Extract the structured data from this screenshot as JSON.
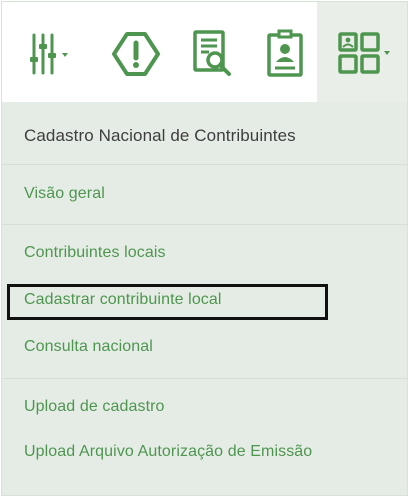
{
  "toolbar": {
    "buttons": [
      {
        "icon": "equalizer-sliders-icon",
        "has_dropdown": true
      },
      {
        "icon": "octagon-exclamation-icon",
        "has_dropdown": false
      },
      {
        "icon": "document-search-icon",
        "has_dropdown": false
      },
      {
        "icon": "id-badge-icon",
        "has_dropdown": false
      },
      {
        "icon": "app-grid-icon",
        "has_dropdown": true,
        "active": true
      }
    ],
    "colors": {
      "icon": "#4e9650",
      "active_background": "#e9eee9"
    }
  },
  "menu": {
    "header": "Cadastro Nacional de Contribuintes",
    "groups": [
      {
        "items": [
          {
            "label": "Visão geral"
          }
        ]
      },
      {
        "items": [
          {
            "label": "Contribuintes locais"
          },
          {
            "label": "Cadastrar contribuinte local",
            "highlighted": true
          },
          {
            "label": "Consulta nacional"
          }
        ]
      },
      {
        "items": [
          {
            "label": "Upload de cadastro"
          },
          {
            "label": "Upload Arquivo Autorização de Emissão"
          }
        ]
      }
    ],
    "colors": {
      "header_text": "#3e3e3e",
      "item_text": "#4e9650",
      "background": "#e5ece5",
      "highlight_border": "#111111"
    }
  }
}
